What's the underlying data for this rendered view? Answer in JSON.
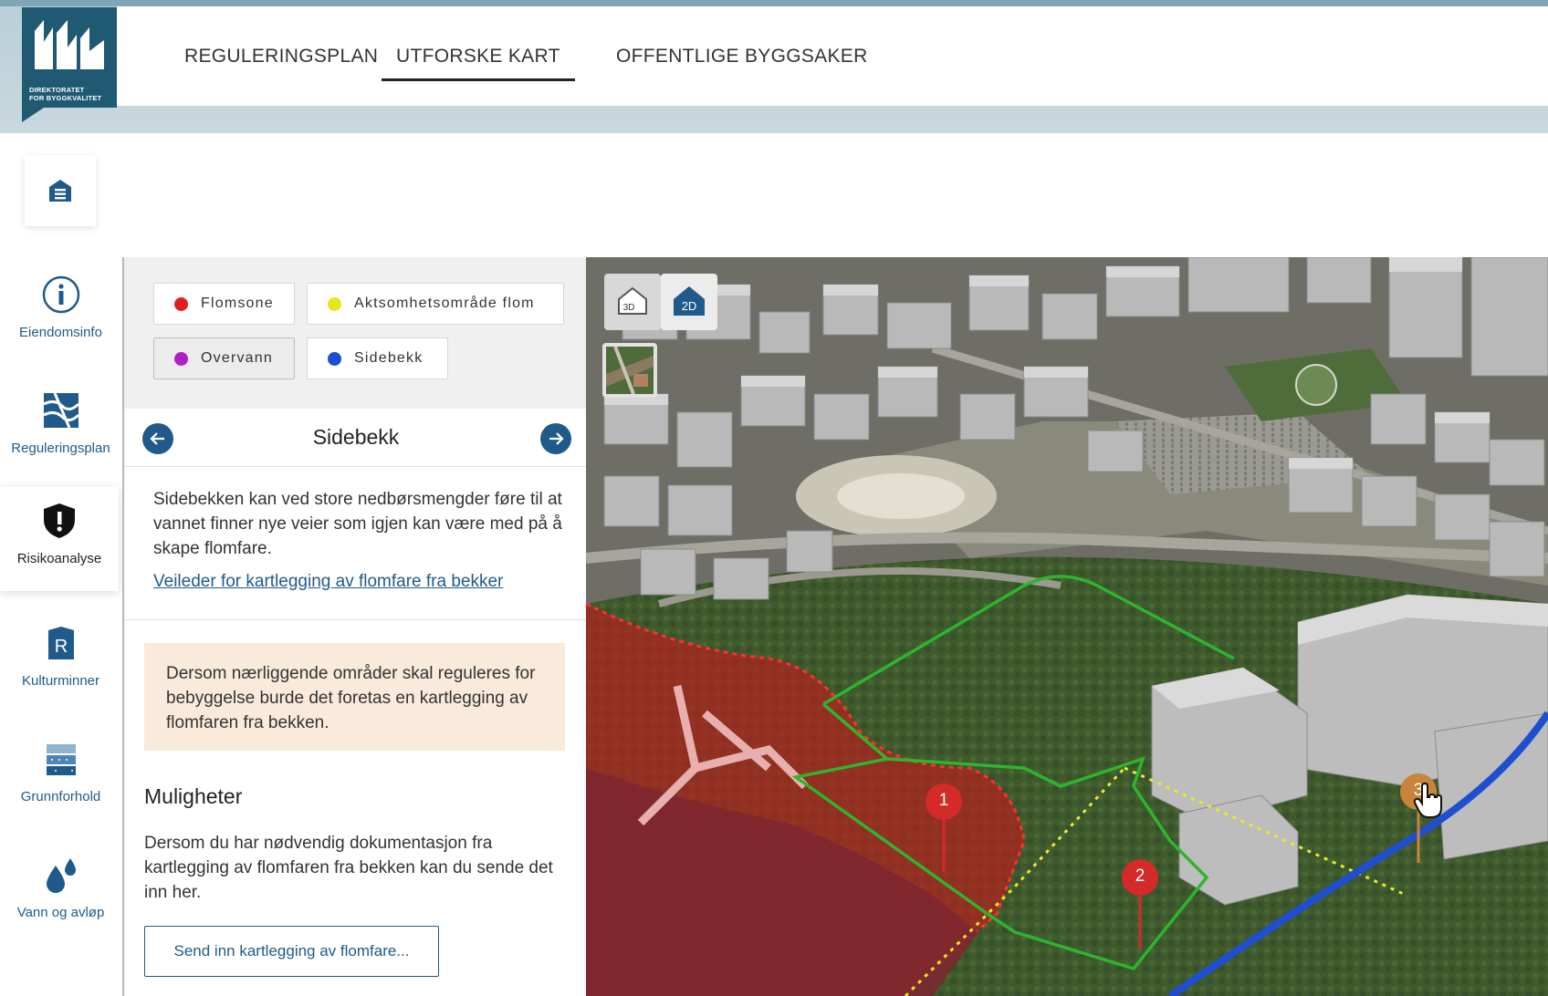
{
  "logo": {
    "line1": "DIREKTORATET",
    "line2": "FOR BYGGKVALITET"
  },
  "nav": [
    {
      "label": "REGULERINGSPLAN",
      "active": false
    },
    {
      "label": "UTFORSKE KART",
      "active": true
    },
    {
      "label": "OFFENTLIGE BYGGSAKER",
      "active": false
    }
  ],
  "rail": {
    "top_button_icon": "list-menu-icon",
    "items": [
      {
        "label": "Eiendomsinfo",
        "icon": "info-icon"
      },
      {
        "label": "Reguleringsplan",
        "icon": "zoning-map-icon"
      },
      {
        "label": "Risikoanalyse",
        "icon": "shield-alert-icon",
        "active": true
      },
      {
        "label": "Kulturminner",
        "icon": "heritage-icon"
      },
      {
        "label": "Grunnforhold",
        "icon": "ground-layers-icon"
      },
      {
        "label": "Vann og avløp",
        "icon": "water-drops-icon"
      }
    ]
  },
  "legend": [
    {
      "label": "Flomsone",
      "color": "#e02020"
    },
    {
      "label": "Aktsomhetsområde flom",
      "color": "#e6e61a"
    },
    {
      "label": "Overvann",
      "color": "#b01ec8"
    },
    {
      "label": "Sidebekk",
      "color": "#1c4fd0"
    }
  ],
  "panel": {
    "title": "Sidebekk",
    "description": "Sidebekken kan ved store nedbørsmengder føre til at vannet finner nye veier som igjen kan være med på å skape flomfare.",
    "link": "Veileder for kartlegging av flomfare fra bekker",
    "note": "Dersom nærliggende områder skal reguleres for bebyggelse burde det foretas en kartlegging av flomfaren fra bekken.",
    "subheading": "Muligheter",
    "text": "Dersom du har nødvendig dokumentasjon fra kartlegging av flomfaren fra bekken kan du sende det inn her.",
    "button": "Send inn kartlegging av flomfare..."
  },
  "map": {
    "btn_3d": "3D",
    "btn_2d": "2D",
    "pins": [
      {
        "label": "1",
        "color": "#d42a2a"
      },
      {
        "label": "2",
        "color": "#d42a2a"
      },
      {
        "label": "3",
        "color": "#c8843a"
      }
    ],
    "colors": {
      "flood": "#b3201f",
      "green_line": "#2db52d",
      "blue_line": "#1f4fd0",
      "yellow_line": "#e9e930"
    }
  }
}
